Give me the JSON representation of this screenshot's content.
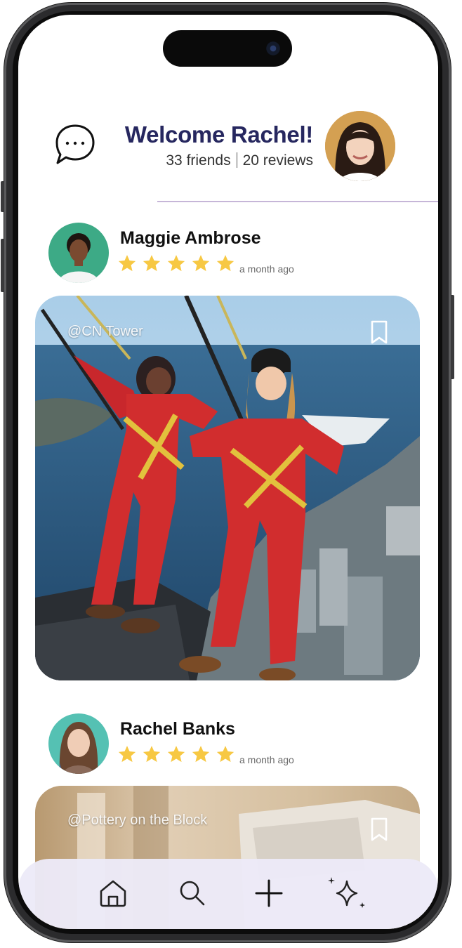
{
  "header": {
    "welcome": "Welcome Rachel!",
    "friends": "33 friends",
    "reviews": "20 reviews",
    "chat_icon": "chat-bubble-icon",
    "accent_color": "#26275f"
  },
  "feed": [
    {
      "name": "Maggie Ambrose",
      "rating": 5,
      "time": "a month ago",
      "place": "@CN Tower",
      "bookmark_icon": "bookmark-icon"
    },
    {
      "name": "Rachel Banks",
      "rating": 5,
      "time": "a month ago",
      "place": "@Pottery on the Block",
      "bookmark_icon": "bookmark-icon"
    }
  ],
  "nav": {
    "items": [
      "home-icon",
      "search-icon",
      "plus-icon",
      "sparkles-icon"
    ]
  },
  "colors": {
    "star": "#f7c843",
    "divider": "#c6b6d8",
    "nav_bg": "#eceaf8"
  }
}
